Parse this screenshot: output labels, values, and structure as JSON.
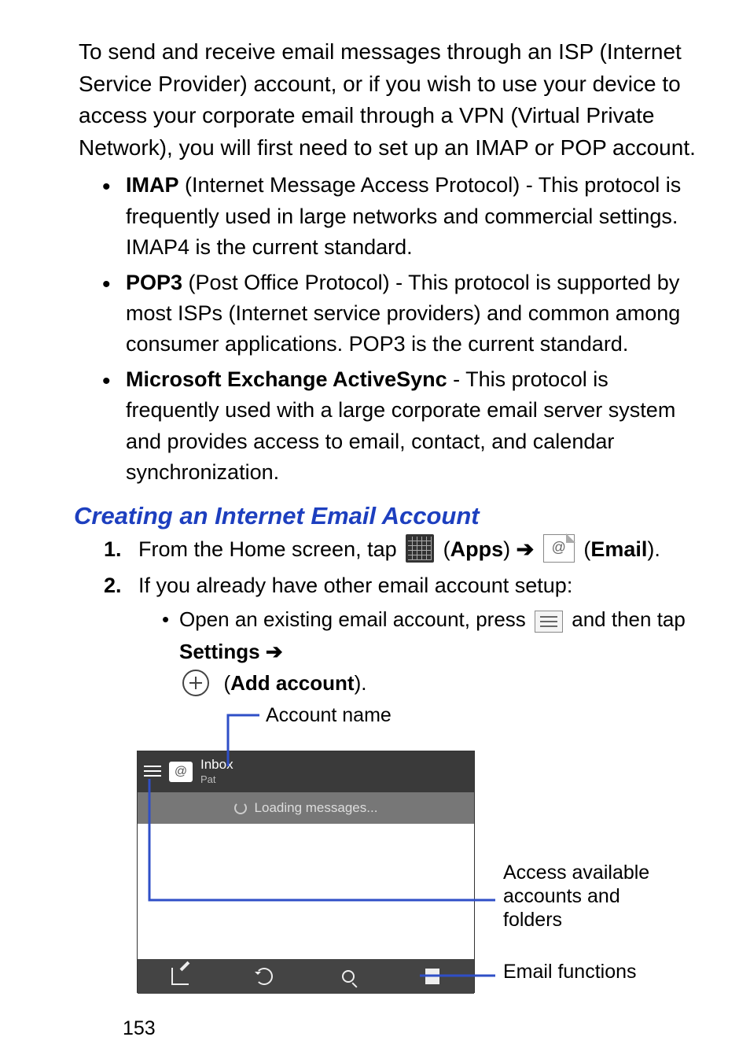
{
  "intro": "To send and receive email messages through an ISP (Internet Service Provider) account, or if you wish to use your device to access your corporate email through a VPN (Virtual Private Network), you will first need to set up an IMAP or POP account.",
  "protocols": [
    {
      "term": "IMAP",
      "desc": " (Internet Message Access Protocol) - This protocol is frequently used in large networks and commercial settings. IMAP4 is the current standard."
    },
    {
      "term": "POP3",
      "desc": " (Post Office Protocol) - This protocol is supported by most ISPs (Internet service providers) and common among consumer applications. POP3 is the current standard."
    },
    {
      "term": "Microsoft Exchange ActiveSync",
      "desc": " - This protocol is frequently used with a large corporate email server system and provides access to email, contact, and calendar synchronization."
    }
  ],
  "section_heading": "Creating an Internet Email Account",
  "steps": {
    "s1_pre": "From the Home screen, tap ",
    "s1_apps": "Apps",
    "s1_arrow": " ➔ ",
    "s1_email": "Email",
    "s2": "If you already have other email account setup:",
    "s2_sub_pre": "Open an existing email account, press ",
    "s2_sub_mid": " and then tap ",
    "s2_sub_settings": "Settings",
    "s2_sub_arrow": " ➔ ",
    "s2_sub_add": "Add account",
    "paren_open": "(",
    "paren_close": ")",
    "period": "."
  },
  "shot": {
    "inbox": "Inbox",
    "account": "Pat",
    "loading": "Loading messages..."
  },
  "callouts": {
    "account_name": "Account name",
    "access": "Access available accounts and folders",
    "functions": "Email functions"
  },
  "page_number": "153"
}
